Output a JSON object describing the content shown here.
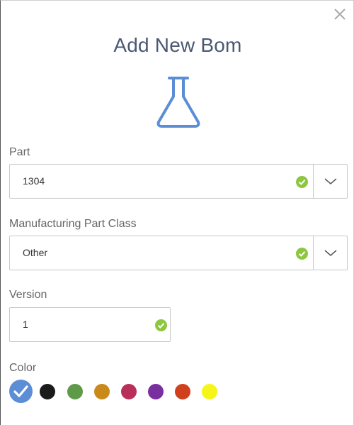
{
  "dialog": {
    "title": "Add New Bom",
    "close_icon": "close-icon",
    "header_icon": "flask-icon"
  },
  "form": {
    "part": {
      "label": "Part",
      "value": "1304",
      "valid": true
    },
    "mfg_part_class": {
      "label": "Manufacturing Part Class",
      "value": "Other",
      "valid": true
    },
    "version": {
      "label": "Version",
      "value": "1",
      "valid": true
    },
    "color": {
      "label": "Color",
      "selected_index": 0,
      "options": [
        "#5b8ed6",
        "#1b1b1b",
        "#5e9a48",
        "#c98a1a",
        "#b8305a",
        "#7a2fa0",
        "#d0401c",
        "#f5f519"
      ]
    }
  },
  "colors": {
    "title": "#4a5872",
    "accent": "#5b8ed6",
    "valid": "#8dc63f",
    "border": "#c8c8c8"
  }
}
